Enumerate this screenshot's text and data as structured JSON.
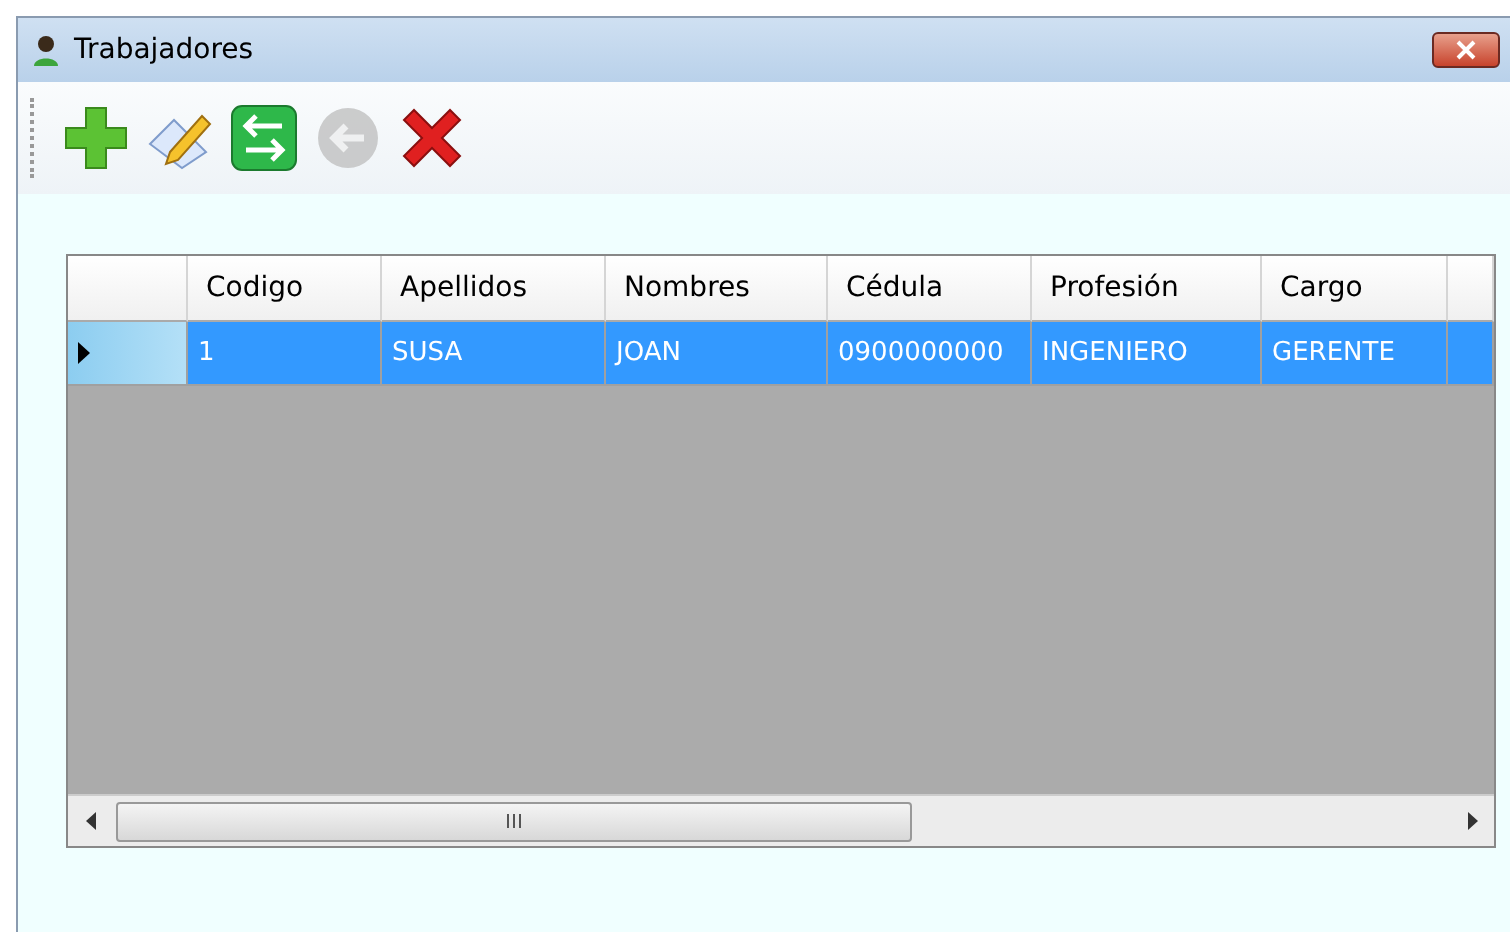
{
  "window": {
    "title": "Trabajadores"
  },
  "toolbar": {
    "buttons": [
      {
        "kind": "add",
        "disabled": false
      },
      {
        "kind": "edit",
        "disabled": false
      },
      {
        "kind": "swap",
        "disabled": false
      },
      {
        "kind": "back",
        "disabled": true
      },
      {
        "kind": "delete",
        "disabled": false
      }
    ]
  },
  "table": {
    "columns": [
      "Codigo",
      "Apellidos",
      "Nombres",
      "Cédula",
      "Profesión",
      "Cargo"
    ],
    "rows": [
      {
        "cells": [
          "1",
          "SUSA",
          "JOAN",
          "0900000000",
          "INGENIERO",
          "GERENTE"
        ],
        "selected": true,
        "current": true
      }
    ]
  }
}
